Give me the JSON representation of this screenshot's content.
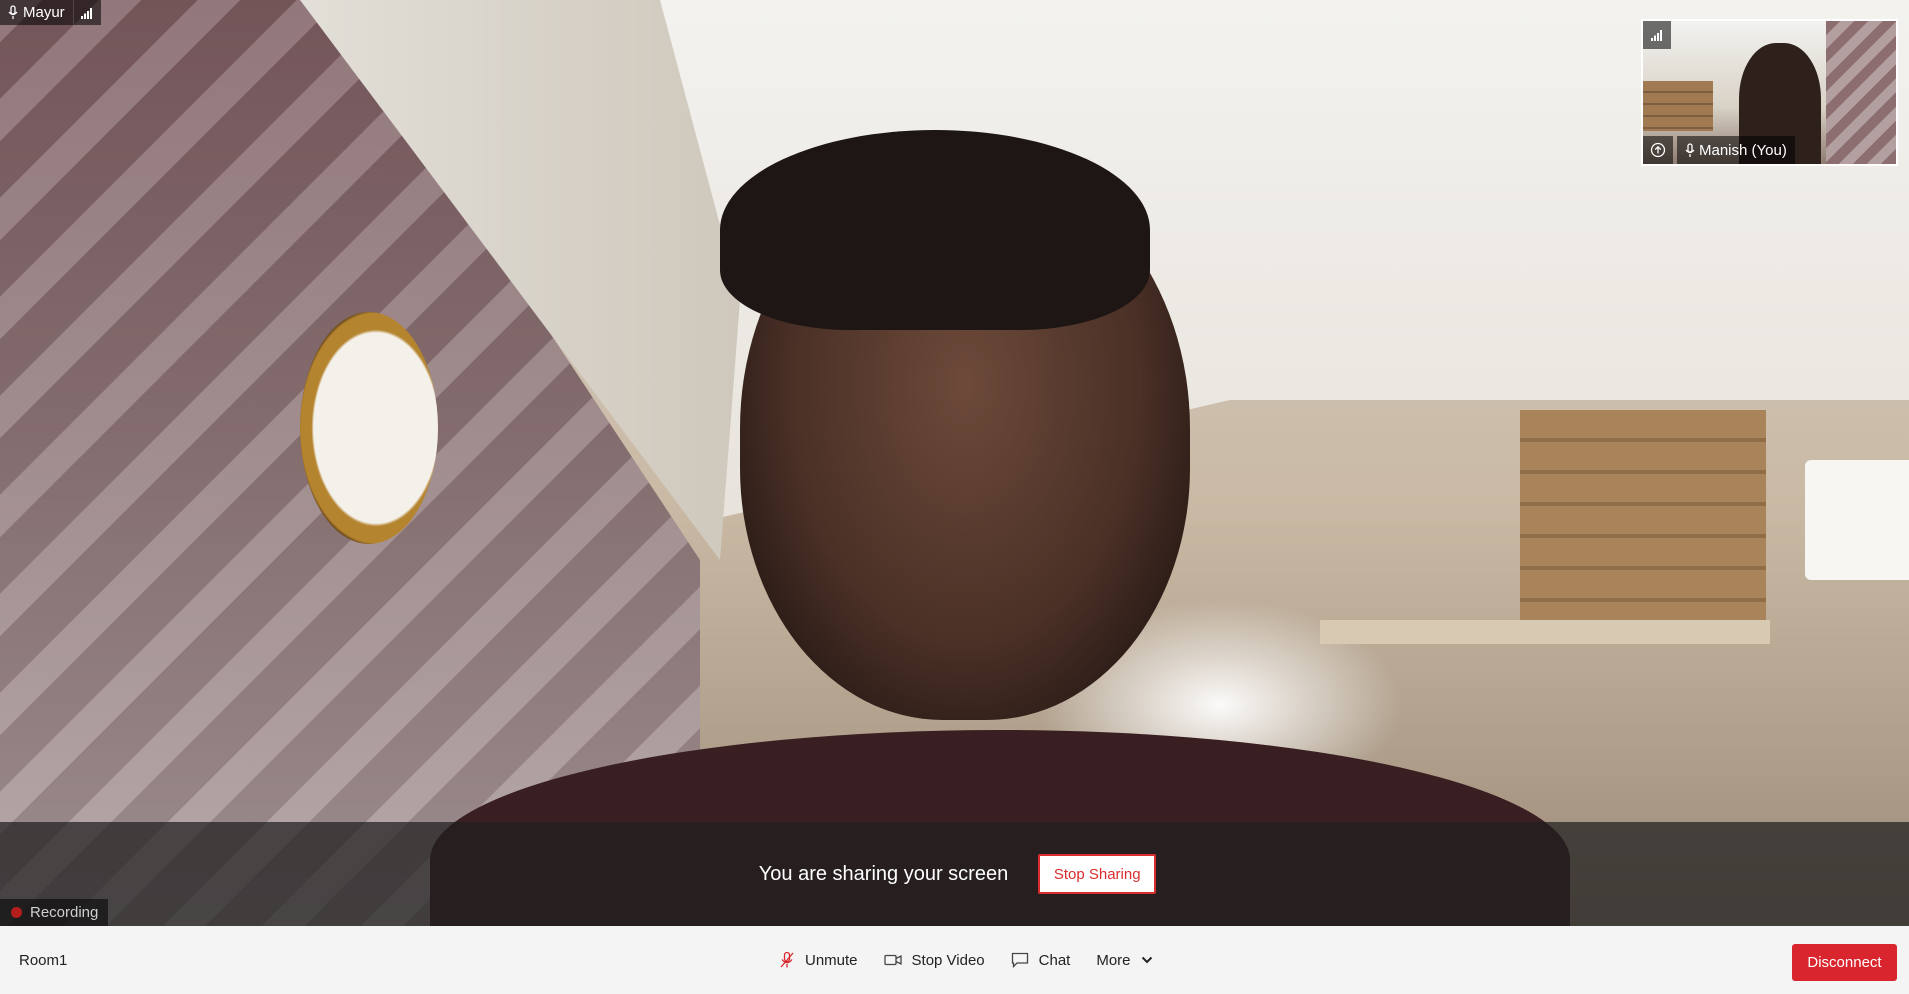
{
  "remote_participant": {
    "name": "Mayur",
    "icons": [
      "microphone-icon",
      "network-signal-icon"
    ]
  },
  "self_view": {
    "name": "Manish (You)",
    "icons": [
      "network-signal-icon",
      "upload-icon",
      "microphone-icon"
    ]
  },
  "screen_share": {
    "message": "You are sharing your screen",
    "stop_label": "Stop Sharing"
  },
  "recording": {
    "label": "Recording",
    "color": "#b61d1d"
  },
  "toolbar": {
    "room_name": "Room1",
    "unmute_label": "Unmute",
    "stop_video_label": "Stop Video",
    "chat_label": "Chat",
    "more_label": "More",
    "disconnect_label": "Disconnect",
    "icons": [
      "microphone-muted-icon",
      "video-camera-icon",
      "chat-bubble-icon",
      "chevron-down-icon"
    ]
  },
  "colors": {
    "accent_red": "#d9262e",
    "toolbar_bg": "#f4f4f4"
  }
}
